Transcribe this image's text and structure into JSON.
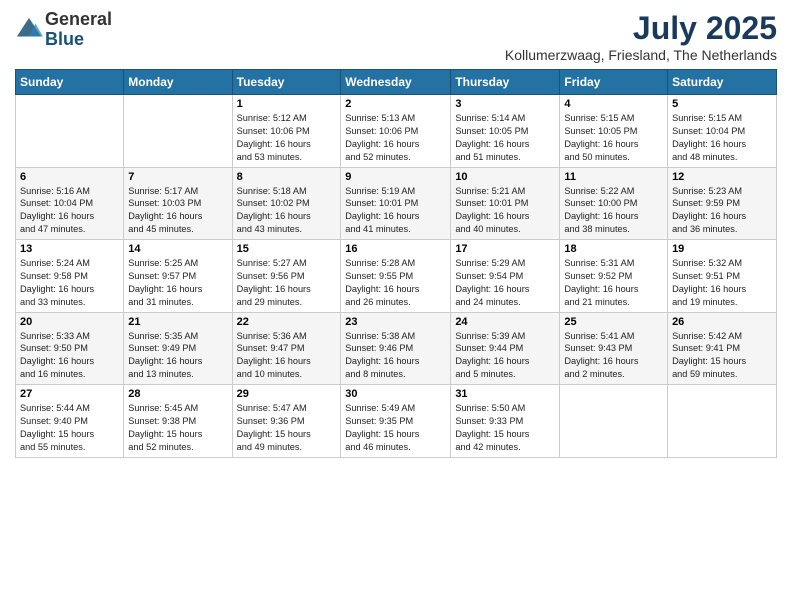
{
  "logo": {
    "general": "General",
    "blue": "Blue"
  },
  "title": "July 2025",
  "location": "Kollumerzwaag, Friesland, The Netherlands",
  "days_header": [
    "Sunday",
    "Monday",
    "Tuesday",
    "Wednesday",
    "Thursday",
    "Friday",
    "Saturday"
  ],
  "weeks": [
    [
      {
        "day": "",
        "info": ""
      },
      {
        "day": "",
        "info": ""
      },
      {
        "day": "1",
        "info": "Sunrise: 5:12 AM\nSunset: 10:06 PM\nDaylight: 16 hours\nand 53 minutes."
      },
      {
        "day": "2",
        "info": "Sunrise: 5:13 AM\nSunset: 10:06 PM\nDaylight: 16 hours\nand 52 minutes."
      },
      {
        "day": "3",
        "info": "Sunrise: 5:14 AM\nSunset: 10:05 PM\nDaylight: 16 hours\nand 51 minutes."
      },
      {
        "day": "4",
        "info": "Sunrise: 5:15 AM\nSunset: 10:05 PM\nDaylight: 16 hours\nand 50 minutes."
      },
      {
        "day": "5",
        "info": "Sunrise: 5:15 AM\nSunset: 10:04 PM\nDaylight: 16 hours\nand 48 minutes."
      }
    ],
    [
      {
        "day": "6",
        "info": "Sunrise: 5:16 AM\nSunset: 10:04 PM\nDaylight: 16 hours\nand 47 minutes."
      },
      {
        "day": "7",
        "info": "Sunrise: 5:17 AM\nSunset: 10:03 PM\nDaylight: 16 hours\nand 45 minutes."
      },
      {
        "day": "8",
        "info": "Sunrise: 5:18 AM\nSunset: 10:02 PM\nDaylight: 16 hours\nand 43 minutes."
      },
      {
        "day": "9",
        "info": "Sunrise: 5:19 AM\nSunset: 10:01 PM\nDaylight: 16 hours\nand 41 minutes."
      },
      {
        "day": "10",
        "info": "Sunrise: 5:21 AM\nSunset: 10:01 PM\nDaylight: 16 hours\nand 40 minutes."
      },
      {
        "day": "11",
        "info": "Sunrise: 5:22 AM\nSunset: 10:00 PM\nDaylight: 16 hours\nand 38 minutes."
      },
      {
        "day": "12",
        "info": "Sunrise: 5:23 AM\nSunset: 9:59 PM\nDaylight: 16 hours\nand 36 minutes."
      }
    ],
    [
      {
        "day": "13",
        "info": "Sunrise: 5:24 AM\nSunset: 9:58 PM\nDaylight: 16 hours\nand 33 minutes."
      },
      {
        "day": "14",
        "info": "Sunrise: 5:25 AM\nSunset: 9:57 PM\nDaylight: 16 hours\nand 31 minutes."
      },
      {
        "day": "15",
        "info": "Sunrise: 5:27 AM\nSunset: 9:56 PM\nDaylight: 16 hours\nand 29 minutes."
      },
      {
        "day": "16",
        "info": "Sunrise: 5:28 AM\nSunset: 9:55 PM\nDaylight: 16 hours\nand 26 minutes."
      },
      {
        "day": "17",
        "info": "Sunrise: 5:29 AM\nSunset: 9:54 PM\nDaylight: 16 hours\nand 24 minutes."
      },
      {
        "day": "18",
        "info": "Sunrise: 5:31 AM\nSunset: 9:52 PM\nDaylight: 16 hours\nand 21 minutes."
      },
      {
        "day": "19",
        "info": "Sunrise: 5:32 AM\nSunset: 9:51 PM\nDaylight: 16 hours\nand 19 minutes."
      }
    ],
    [
      {
        "day": "20",
        "info": "Sunrise: 5:33 AM\nSunset: 9:50 PM\nDaylight: 16 hours\nand 16 minutes."
      },
      {
        "day": "21",
        "info": "Sunrise: 5:35 AM\nSunset: 9:49 PM\nDaylight: 16 hours\nand 13 minutes."
      },
      {
        "day": "22",
        "info": "Sunrise: 5:36 AM\nSunset: 9:47 PM\nDaylight: 16 hours\nand 10 minutes."
      },
      {
        "day": "23",
        "info": "Sunrise: 5:38 AM\nSunset: 9:46 PM\nDaylight: 16 hours\nand 8 minutes."
      },
      {
        "day": "24",
        "info": "Sunrise: 5:39 AM\nSunset: 9:44 PM\nDaylight: 16 hours\nand 5 minutes."
      },
      {
        "day": "25",
        "info": "Sunrise: 5:41 AM\nSunset: 9:43 PM\nDaylight: 16 hours\nand 2 minutes."
      },
      {
        "day": "26",
        "info": "Sunrise: 5:42 AM\nSunset: 9:41 PM\nDaylight: 15 hours\nand 59 minutes."
      }
    ],
    [
      {
        "day": "27",
        "info": "Sunrise: 5:44 AM\nSunset: 9:40 PM\nDaylight: 15 hours\nand 55 minutes."
      },
      {
        "day": "28",
        "info": "Sunrise: 5:45 AM\nSunset: 9:38 PM\nDaylight: 15 hours\nand 52 minutes."
      },
      {
        "day": "29",
        "info": "Sunrise: 5:47 AM\nSunset: 9:36 PM\nDaylight: 15 hours\nand 49 minutes."
      },
      {
        "day": "30",
        "info": "Sunrise: 5:49 AM\nSunset: 9:35 PM\nDaylight: 15 hours\nand 46 minutes."
      },
      {
        "day": "31",
        "info": "Sunrise: 5:50 AM\nSunset: 9:33 PM\nDaylight: 15 hours\nand 42 minutes."
      },
      {
        "day": "",
        "info": ""
      },
      {
        "day": "",
        "info": ""
      }
    ]
  ]
}
